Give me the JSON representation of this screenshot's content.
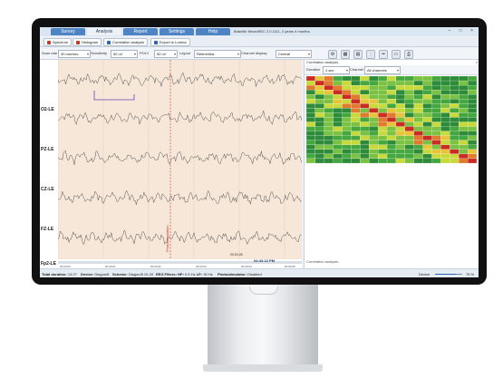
{
  "tabs": [
    {
      "label": "Survey",
      "active": false
    },
    {
      "label": "Analysis",
      "active": true
    },
    {
      "label": "Report",
      "active": false
    },
    {
      "label": "Settings",
      "active": false
    },
    {
      "label": "Help",
      "active": false
    }
  ],
  "window_title": "Brainfile NeuroREC 2.0.1111, 2 years 4 months",
  "window_buttons": "– □ ×",
  "toolbar": {
    "spectrum": "Spectrum",
    "histogram": "Histogram",
    "correlation": "Correlation analysis",
    "export": "Export to Lorena"
  },
  "settings_bar": {
    "scan_rate_label": "Scan rate",
    "scan_rate_value": "30 mm/sec",
    "sensitivity_label": "Sensitivity",
    "sensitivity_value": "50 uV",
    "poly_label": "POLY",
    "poly_value": "50 uV",
    "layout_label": "Layout",
    "layout_value": "Referential",
    "channel_display_label": "Channel display",
    "channel_display_value": "Central",
    "icons": [
      "zoom-in-icon",
      "zoom-out-icon",
      "montage-icon",
      "grid-icon",
      "marker-icon",
      "ruler-icon",
      "print-icon"
    ]
  },
  "eeg": {
    "channels": [
      "O2-LE",
      "PZ-LE",
      "CZ-LE",
      "FZ-LE",
      "Fp2-LE"
    ],
    "time_labels": [
      "00:00:00",
      "00:00:01",
      "00:00:02",
      "00:00:03",
      "00:00:04",
      "00:00:05"
    ],
    "cursor_time": "00:00:28",
    "event_label": "Photostimulation",
    "clock": "04:43:12 PM",
    "colors": {
      "background": "#f7e7d8",
      "trace": "#555555",
      "event": "#c0392b",
      "marker": "#6a3fb5"
    }
  },
  "correlation": {
    "title": "Correlation analysis",
    "close": "×",
    "duration_label": "Duration",
    "duration_value": "4 sec",
    "channel_label": "Channel",
    "channel_value": "All channels",
    "footer": "Correlation analysis",
    "size": 19
  },
  "status": {
    "total_duration_label": "Total duration:",
    "total_duration_value": "13:27",
    "device_label": "Device:",
    "device_value": "Diagon/8",
    "scheme_label": "Scheme:",
    "scheme_value": "Diagon/8 10-20",
    "eeg_filters_label": "EEG Filters:",
    "hp_label": "HP:",
    "hp_value": "0.5 Hz",
    "lp_label": "LP:",
    "lp_value": "30 Hz",
    "photostim_label": "Photostimulator:",
    "photostim_value": "Disabled",
    "device_right_label": "Device",
    "zoom_value": "75 %",
    "zoom_fraction": 0.75
  }
}
